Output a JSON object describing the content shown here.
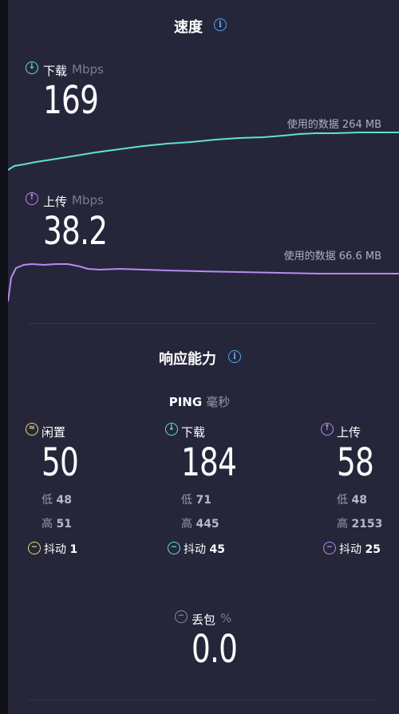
{
  "speed": {
    "title": "速度",
    "download": {
      "label": "下载",
      "unit": "Mbps",
      "value": "169",
      "data_used": "使用的数据 264 MB"
    },
    "upload": {
      "label": "上传",
      "unit": "Mbps",
      "value": "38.2",
      "data_used": "使用的数据 66.6 MB"
    }
  },
  "responsiveness": {
    "title": "响应能力",
    "ping_label": "PING",
    "ping_unit": "毫秒",
    "columns": [
      {
        "label": "闲置",
        "value": "50",
        "low_label": "低",
        "low": "48",
        "high_label": "高",
        "high": "51",
        "jitter_label": "抖动",
        "jitter": "1"
      },
      {
        "label": "下载",
        "value": "184",
        "low_label": "低",
        "low": "71",
        "high_label": "高",
        "high": "445",
        "jitter_label": "抖动",
        "jitter": "45"
      },
      {
        "label": "上传",
        "value": "58",
        "low_label": "低",
        "low": "48",
        "high_label": "高",
        "high": "2153",
        "jitter_label": "抖动",
        "jitter": "25"
      }
    ],
    "packet_loss": {
      "label": "丢包",
      "unit": "%",
      "value": "0.0"
    }
  },
  "colors": {
    "download": "#5fe0d6",
    "upload": "#b98bf0",
    "idle": "#e9d77a",
    "background": "#26263a"
  }
}
